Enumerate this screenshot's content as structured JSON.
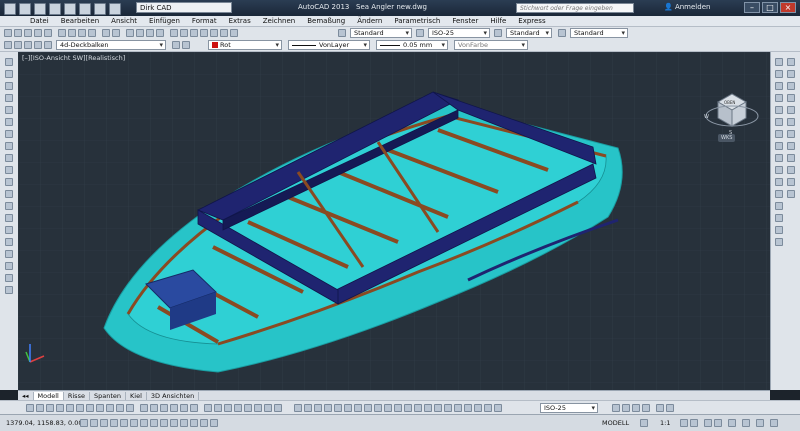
{
  "titlebar": {
    "workspace": "Dirk CAD",
    "app_name": "AutoCAD 2013",
    "file_name": "Sea Angler new.dwg",
    "search_placeholder": "Stichwort oder Frage eingeben",
    "signin": "Anmelden"
  },
  "menu": [
    "Datei",
    "Bearbeiten",
    "Ansicht",
    "Einfügen",
    "Format",
    "Extras",
    "Zeichnen",
    "Bemaßung",
    "Ändern",
    "Parametrisch",
    "Fenster",
    "Hilfe",
    "Express"
  ],
  "toolbar_styles": {
    "text_style": "Standard",
    "dim_style": "ISO-25",
    "table_style": "Standard",
    "multileader_style": "Standard"
  },
  "layer_bar": {
    "layer": "4d-Deckbalken",
    "color": "Rot",
    "color_swatch": "#cc1111",
    "linetype": "VonLayer",
    "lineweight": "0.05 mm",
    "plotstyle": "VonFarbe"
  },
  "viewport": {
    "label": "[–][ISO-Ansicht SW][Realistisch]",
    "background": "#27313b",
    "hull_color": "#27c4c8",
    "frame_color": "#1f2470",
    "wood_color": "#8a4a22",
    "viewcube_labels": [
      "OBEN",
      "W",
      "S"
    ],
    "wcs": "WKS"
  },
  "tabs": [
    "Modell",
    "Risse",
    "Spanten",
    "Kiel",
    "3D Ansichten"
  ],
  "bottom_toolbar": {
    "dim_style": "ISO-25"
  },
  "status": {
    "coords": "1379.04, 1158.83, 0.00",
    "mode": "MODELL",
    "scale": "1:1"
  }
}
